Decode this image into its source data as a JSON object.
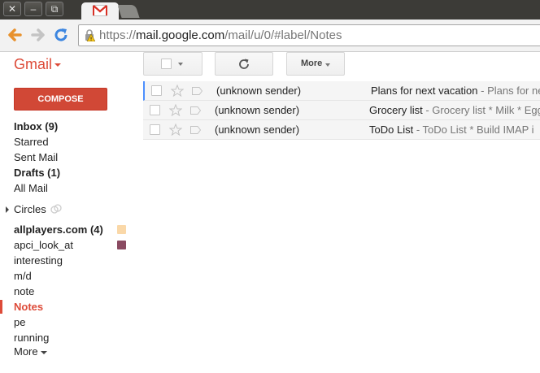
{
  "browser": {
    "window_buttons": {
      "close": "✕",
      "minimize": "–",
      "restore": "⧉"
    },
    "tab": {
      "icon": "gmail-favicon-icon"
    },
    "url": {
      "scheme": "https://",
      "host": "mail.google.com",
      "path": "/mail/u/0/#label/Notes"
    },
    "icons": {
      "back": "back-arrow-icon",
      "forward": "forward-arrow-icon",
      "reload": "reload-icon",
      "security": "warning-lock-icon"
    }
  },
  "gmail": {
    "logo": "Gmail",
    "toolbar": {
      "more_label": "More"
    },
    "compose_label": "COMPOSE",
    "nav": {
      "inbox": "Inbox (9)",
      "starred": "Starred",
      "sent": "Sent Mail",
      "drafts": "Drafts (1)",
      "all": "All Mail",
      "circles": "Circles",
      "allplayers": "allplayers.com (4)",
      "apci": "apci_look_at",
      "interesting": "interesting",
      "md": "m/d",
      "note": "note",
      "notes": "Notes",
      "pe": "pe",
      "running": "running",
      "more": "More"
    },
    "label_colors": {
      "allplayers": "#fad8a8",
      "apci": "#8a4a61"
    },
    "accent": "#dd4b39",
    "messages": [
      {
        "sender": "(unknown sender)",
        "subject": "Plans for next vacation",
        "snippet": " - Plans for ne"
      },
      {
        "sender": "(unknown sender)",
        "subject": "Grocery list",
        "snippet": " - Grocery list * Milk * Egg"
      },
      {
        "sender": "(unknown sender)",
        "subject": "ToDo List",
        "snippet": " - ToDo List * Build IMAP i"
      }
    ]
  }
}
